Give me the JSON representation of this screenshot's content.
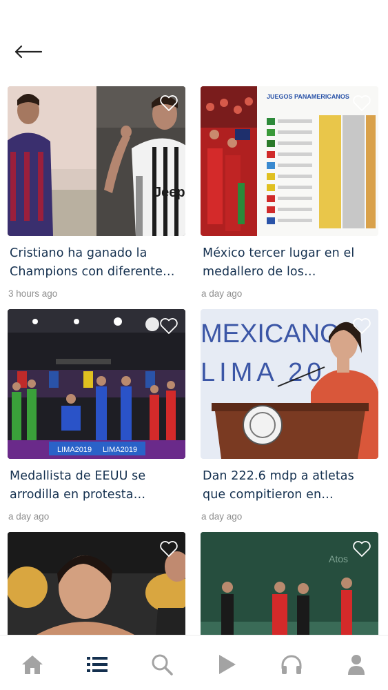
{
  "header": {
    "back_icon": "arrow-left-icon"
  },
  "cards": [
    {
      "title": "Cristiano ha ganado la Champions con diferente…",
      "time": "3 hours ago",
      "favorite_icon": "heart-outline-icon"
    },
    {
      "title": "México tercer lugar en el medallero de los…",
      "time": "a day ago",
      "favorite_icon": "heart-outline-icon",
      "image_text": {
        "banner": "JUEGOS PANAMERICANOS"
      }
    },
    {
      "title": "Medallista de EEUU se arrodilla en protesta…",
      "time": "a day ago",
      "favorite_icon": "heart-outline-icon",
      "image_text": {
        "board_left": "LIMA2019",
        "board_right": "LIMA2019"
      }
    },
    {
      "title": "Dan 222.6 mdp a atletas que compitieron en…",
      "time": "a day ago",
      "favorite_icon": "heart-outline-icon",
      "image_text": {
        "line1": "MEXICANO",
        "line2": "LIMA 20"
      }
    },
    {
      "title": "",
      "time": "",
      "favorite_icon": "heart-outline-icon"
    },
    {
      "title": "",
      "time": "",
      "favorite_icon": "heart-outline-icon",
      "image_text": {
        "wall": "Atos"
      }
    }
  ],
  "nav": {
    "items": [
      {
        "icon": "home-icon",
        "active": false
      },
      {
        "icon": "list-icon",
        "active": true
      },
      {
        "icon": "search-icon",
        "active": false
      },
      {
        "icon": "play-icon",
        "active": false
      },
      {
        "icon": "headphones-icon",
        "active": false
      },
      {
        "icon": "user-icon",
        "active": false
      }
    ],
    "colors": {
      "active": "#14304f",
      "inactive": "#a3a3a3"
    }
  },
  "colors": {
    "title": "#14304f",
    "time": "#8e8e8e",
    "background": "#ffffff"
  }
}
